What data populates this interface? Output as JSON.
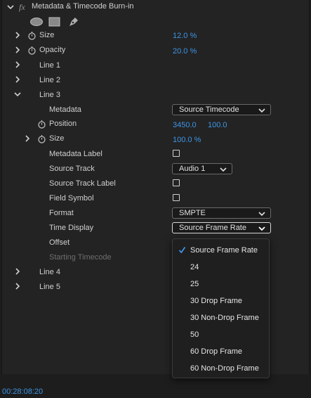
{
  "header": {
    "fx_label": "fx",
    "title": "Metadata & Timecode Burn-in"
  },
  "tools": [
    "ellipse-mask-tool",
    "rectangle-mask-tool",
    "pen-mask-tool"
  ],
  "properties": {
    "size_label": "Size",
    "size_value": "12.0 %",
    "opacity_label": "Opacity",
    "opacity_value": "20.0 %",
    "line1": "Line 1",
    "line2": "Line 2",
    "line3": "Line 3",
    "line3_children": {
      "metadata_label": "Metadata",
      "metadata_value": "Source Timecode",
      "position_label": "Position",
      "position_x": "3450.0",
      "position_y": "100.0",
      "size_label": "Size",
      "size_value": "100.0 %",
      "metadata_label_label": "Metadata Label",
      "source_track_label": "Source Track",
      "source_track_value": "Audio 1",
      "source_track_label_label": "Source Track Label",
      "field_symbol_label": "Field Symbol",
      "format_label": "Format",
      "format_value": "SMPTE",
      "time_display_label": "Time Display",
      "time_display_value": "Source Frame Rate",
      "offset_label": "Offset",
      "starting_timecode_label": "Starting Timecode"
    },
    "line4": "Line 4",
    "line5": "Line 5"
  },
  "time_display_menu": {
    "selected_index": 0,
    "options": [
      "Source Frame Rate",
      "24",
      "25",
      "30 Drop Frame",
      "30 Non-Drop Frame",
      "50",
      "60 Drop Frame",
      "60 Non-Drop Frame"
    ]
  },
  "footer": {
    "timecode": "00:28:08:20"
  },
  "colors": {
    "accent_blue": "#3d95e6",
    "panel_bg": "#232323"
  }
}
